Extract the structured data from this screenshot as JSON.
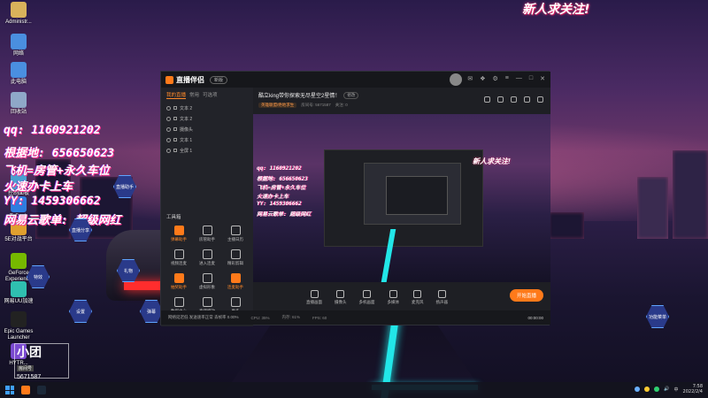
{
  "desktop": {
    "icons": [
      {
        "label": "Administr...",
        "color": "#d9b25b"
      },
      {
        "label": "网络",
        "color": "#4a8fe0"
      },
      {
        "label": "此电脑",
        "color": "#4a8fe0"
      },
      {
        "label": "回收站",
        "color": "#8fa8c8"
      },
      {
        "label": "控制面板",
        "color": "#4aa0d0"
      },
      {
        "label": "ToDesk",
        "color": "#2f7de0"
      },
      {
        "label": "5E对战平台",
        "color": "#e0a02f"
      },
      {
        "label": "GeForce Experience",
        "color": "#76b900"
      },
      {
        "label": "网易UU加速",
        "color": "#2fc0b0"
      },
      {
        "label": "Epic Games Launcher",
        "color": "#222222"
      },
      {
        "label": "HYTR...",
        "color": "#7a4ad0"
      }
    ],
    "hex_buttons": [
      "直播助手",
      "直播分享",
      "特效",
      "礼物",
      "设置",
      "弹幕",
      "特效",
      "功能菜单"
    ]
  },
  "overlay": {
    "banner": "新人求关注!",
    "ad_lines": [
      "qq: 1160921202",
      "根据地: 656650623",
      "飞机=房管+永久车位",
      "火速办卡上车",
      "YY: 1459306662",
      "网易云歌单: 超级网红"
    ],
    "room_label": "房间号",
    "room_number": "5671587",
    "room_big": "小团"
  },
  "app": {
    "name": "直播伴侣",
    "version": "新版",
    "left_tabs": [
      "我的直播",
      "常用",
      "可选项"
    ],
    "scenes": [
      "文本 2",
      "文本 2",
      "摄像头",
      "文本 1",
      "全屏 1"
    ],
    "toolbox_title": "工具箱",
    "tools": [
      {
        "label": "弹幕助手",
        "orange": true
      },
      {
        "label": "房管助手",
        "orange": false
      },
      {
        "label": "主播日历",
        "orange": false
      },
      {
        "label": "视频连麦",
        "orange": false
      },
      {
        "label": "进入连麦",
        "orange": false
      },
      {
        "label": "精彩剪辑",
        "orange": false
      },
      {
        "label": "抽奖助手",
        "orange": true
      },
      {
        "label": "虚拟形象",
        "orange": false
      },
      {
        "label": "连麦助手",
        "orange": true
      },
      {
        "label": "数据中心",
        "orange": false
      },
      {
        "label": "直播特效",
        "orange": false
      },
      {
        "label": "更多",
        "orange": false
      }
    ],
    "room_title": "酷立king带你探索无尽星空2星情！",
    "room_edit": "修改",
    "room_category": "英雄联盟/绝地求生",
    "room_meta": [
      "房间号: 5671587",
      "关注: 0"
    ],
    "preview": {
      "banner": "新人求关注!",
      "ad_lines": [
        "qq: 1160921202",
        "根据地: 656650623",
        "飞机=房管+永久车位",
        "火速办卡上车",
        "YY: 1459306662",
        "网易云歌单: 超级网红"
      ]
    },
    "bottom_tools": [
      "直播画面",
      "摄像头",
      "多机画面",
      "多媒体",
      "麦克风",
      "扬声器"
    ],
    "start_live": "开始直播",
    "status": {
      "notice": "网络延迟低  发送速率正常  丢帧率 0.00%",
      "cpu": "CPU: 35%",
      "mem": "内存: 61%",
      "fps": "FPS: 60",
      "timer": "00:00:00"
    }
  },
  "taskbar": {
    "time": "7:58",
    "date": "2022/2/4",
    "lang": "中"
  }
}
